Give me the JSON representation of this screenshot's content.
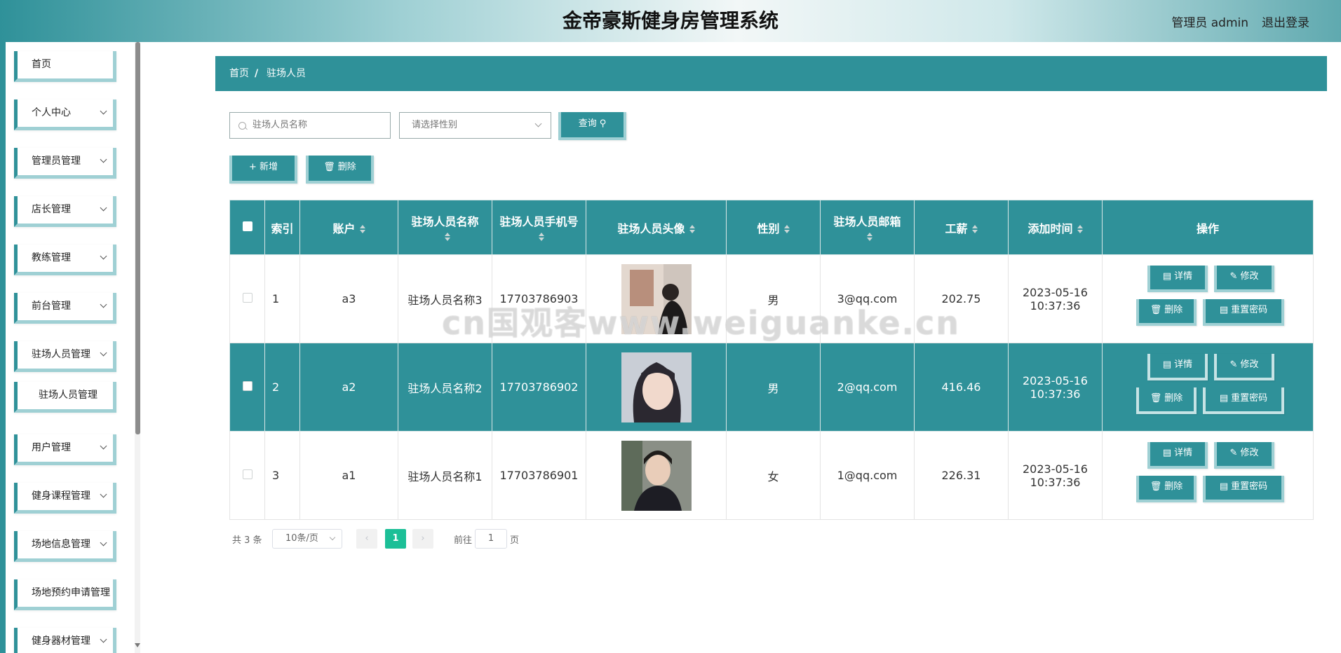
{
  "header": {
    "title": "金帝豪斯健身房管理系统",
    "user": "管理员 admin",
    "logout": "退出登录"
  },
  "sidebar": {
    "items": [
      {
        "label": "首页",
        "has_children": false
      },
      {
        "label": "个人中心",
        "has_children": true
      },
      {
        "label": "管理员管理",
        "has_children": true
      },
      {
        "label": "店长管理",
        "has_children": true
      },
      {
        "label": "教练管理",
        "has_children": true
      },
      {
        "label": "前台管理",
        "has_children": true
      },
      {
        "label": "驻场人员管理",
        "has_children": true
      },
      {
        "label": "驻场人员管理",
        "sub": true
      },
      {
        "label": "用户管理",
        "has_children": true
      },
      {
        "label": "健身课程管理",
        "has_children": true
      },
      {
        "label": "场地信息管理",
        "has_children": true
      },
      {
        "label": "场地预约申请管理",
        "has_children": false
      },
      {
        "label": "健身器材管理",
        "has_children": true
      }
    ]
  },
  "breadcrumb": {
    "home": "首页",
    "sep": "/",
    "current": "驻场人员"
  },
  "search": {
    "name_placeholder": "驻场人员名称",
    "gender_placeholder": "请选择性别",
    "query_label": "查询"
  },
  "toolbar": {
    "add_label": "新增",
    "delete_label": "删除"
  },
  "table": {
    "headers": {
      "index": "索引",
      "account": "账户",
      "name": "驻场人员名称",
      "phone": "驻场人员手机号",
      "avatar": "驻场人员头像",
      "gender": "性别",
      "email": "驻场人员邮箱",
      "salary": "工薪",
      "added": "添加时间",
      "actions": "操作"
    },
    "rows": [
      {
        "index": "1",
        "account": "a3",
        "name": "驻场人员名称3",
        "phone": "17703786903",
        "gender": "男",
        "email": "3@qq.com",
        "salary": "202.75",
        "added": "2023-05-16 10:37:36"
      },
      {
        "index": "2",
        "account": "a2",
        "name": "驻场人员名称2",
        "phone": "17703786902",
        "gender": "男",
        "email": "2@qq.com",
        "salary": "416.46",
        "added": "2023-05-16 10:37:36"
      },
      {
        "index": "3",
        "account": "a1",
        "name": "驻场人员名称1",
        "phone": "17703786901",
        "gender": "女",
        "email": "1@qq.com",
        "salary": "226.31",
        "added": "2023-05-16 10:37:36"
      }
    ],
    "actions": {
      "detail": "详情",
      "edit": "修改",
      "delete": "删除",
      "reset": "重置密码"
    }
  },
  "pagination": {
    "total": "共 3 条",
    "page_size": "10条/页",
    "current": "1",
    "goto": "前往",
    "page_input": "1",
    "page_suffix": "页"
  },
  "watermark": "cn国观客www.weiguanke.cn",
  "colors": {
    "primary": "#2f9199",
    "accent_light": "#9fd0d4",
    "page_active": "#1cbf97"
  }
}
